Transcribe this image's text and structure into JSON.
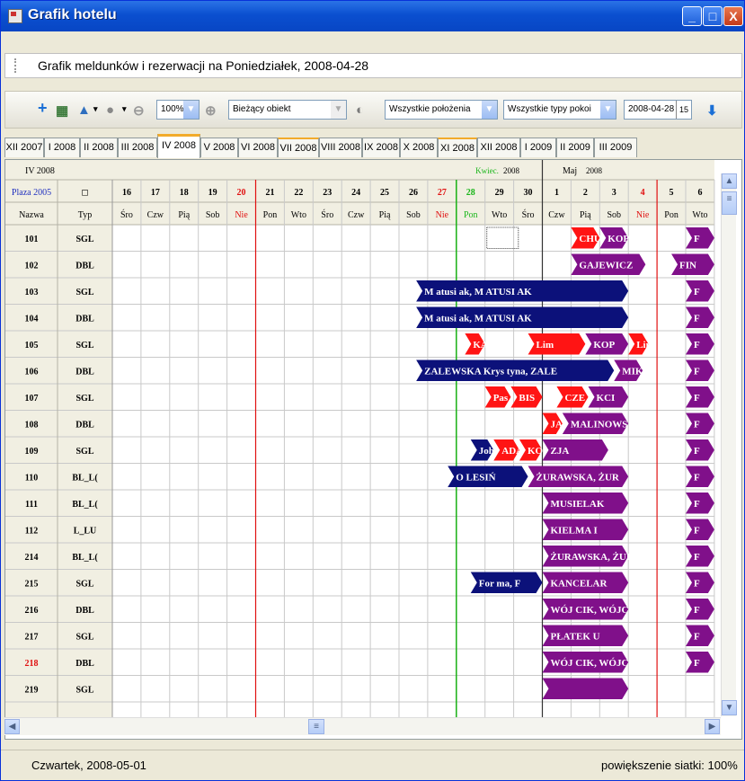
{
  "window": {
    "title": "Grafik hotelu"
  },
  "header": {
    "title": "Grafik meldunków i rezerwacji na Poniedziałek, 2008-04-28"
  },
  "toolbar": {
    "zoom": "100%",
    "object": "Bieżący obiekt",
    "location": "Wszystkie położenia",
    "room_type": "Wszystkie typy pokoi",
    "date": "2008-04-28",
    "calendar_icon": "15"
  },
  "tabs": [
    "XII 2007",
    "I 2008",
    "II 2008",
    "III 2008",
    "IV 2008",
    "V 2008",
    "VI 2008",
    "VII 2008",
    "VIII 2008",
    "IX 2008",
    "X 2008",
    "XI 2008",
    "XII 2008",
    "I 2009",
    "II 2009",
    "III 2009"
  ],
  "active_tab": "IV 2008",
  "grid": {
    "period_label": "IV 2008",
    "month_april": "Kwiec.",
    "month_april_year": "2008",
    "month_may": "Maj",
    "month_may_year": "2008",
    "object_label": "Plaza 2005",
    "col_name": "Nazwa",
    "col_type": "Typ",
    "days": [
      {
        "n": "16",
        "d": "Śro"
      },
      {
        "n": "17",
        "d": "Czw"
      },
      {
        "n": "18",
        "d": "Pią"
      },
      {
        "n": "19",
        "d": "Sob"
      },
      {
        "n": "20",
        "d": "Nie",
        "sun": true
      },
      {
        "n": "21",
        "d": "Pon"
      },
      {
        "n": "22",
        "d": "Wto"
      },
      {
        "n": "23",
        "d": "Śro"
      },
      {
        "n": "24",
        "d": "Czw"
      },
      {
        "n": "25",
        "d": "Pią"
      },
      {
        "n": "26",
        "d": "Sob"
      },
      {
        "n": "27",
        "d": "Nie",
        "sun": true
      },
      {
        "n": "28",
        "d": "Pon",
        "today": true
      },
      {
        "n": "29",
        "d": "Wto"
      },
      {
        "n": "30",
        "d": "Śro"
      },
      {
        "n": "1",
        "d": "Czw"
      },
      {
        "n": "2",
        "d": "Pią"
      },
      {
        "n": "3",
        "d": "Sob"
      },
      {
        "n": "4",
        "d": "Nie",
        "sun": true
      },
      {
        "n": "5",
        "d": "Pon"
      },
      {
        "n": "6",
        "d": "Wto"
      }
    ],
    "rooms": [
      {
        "room": "101",
        "type": "SGL"
      },
      {
        "room": "102",
        "type": "DBL"
      },
      {
        "room": "103",
        "type": "SGL"
      },
      {
        "room": "104",
        "type": "DBL"
      },
      {
        "room": "105",
        "type": "SGL"
      },
      {
        "room": "106",
        "type": "DBL"
      },
      {
        "room": "107",
        "type": "SGL"
      },
      {
        "room": "108",
        "type": "DBL"
      },
      {
        "room": "109",
        "type": "SGL"
      },
      {
        "room": "110",
        "type": "BL_L("
      },
      {
        "room": "111",
        "type": "BL_L("
      },
      {
        "room": "112",
        "type": "L_LU"
      },
      {
        "room": "214",
        "type": "BL_L("
      },
      {
        "room": "215",
        "type": "SGL"
      },
      {
        "room": "216",
        "type": "DBL"
      },
      {
        "room": "217",
        "type": "SGL"
      },
      {
        "room": "218",
        "type": "DBL",
        "red": true
      },
      {
        "room": "219",
        "type": "SGL"
      }
    ],
    "bookings": [
      {
        "row": 0,
        "start": 16,
        "end": 17,
        "color": "red",
        "label": "CHU"
      },
      {
        "row": 0,
        "start": 17,
        "end": 18,
        "color": "purple",
        "label": "KOP"
      },
      {
        "row": 0,
        "start": 20,
        "end": 21,
        "color": "purple",
        "label": "F"
      },
      {
        "row": 1,
        "start": 16,
        "end": 18.6,
        "color": "purple",
        "label": "GAJEWICZ"
      },
      {
        "row": 1,
        "start": 19.5,
        "end": 21,
        "color": "purple",
        "label": "FIN"
      },
      {
        "row": 2,
        "start": 10.6,
        "end": 18,
        "color": "navy",
        "label": "M atusi ak, M ATUSI AK"
      },
      {
        "row": 2,
        "start": 20,
        "end": 21,
        "color": "purple",
        "label": "F"
      },
      {
        "row": 3,
        "start": 10.6,
        "end": 18,
        "color": "navy",
        "label": "M atusi ak, M ATUSI AK"
      },
      {
        "row": 3,
        "start": 20,
        "end": 21,
        "color": "purple",
        "label": "F"
      },
      {
        "row": 4,
        "start": 12.3,
        "end": 13,
        "color": "red",
        "label": "KAC"
      },
      {
        "row": 4,
        "start": 14.5,
        "end": 16.5,
        "color": "red",
        "label": "Lim"
      },
      {
        "row": 4,
        "start": 16.5,
        "end": 18,
        "color": "purple",
        "label": "KOP"
      },
      {
        "row": 4,
        "start": 18,
        "end": 18.7,
        "color": "red",
        "label": "Lim"
      },
      {
        "row": 4,
        "start": 20,
        "end": 21,
        "color": "purple",
        "label": "F"
      },
      {
        "row": 5,
        "start": 10.6,
        "end": 17.5,
        "color": "navy",
        "label": "ZALEWSKA Krys tyna, ZALE"
      },
      {
        "row": 5,
        "start": 17.5,
        "end": 18.5,
        "color": "purple",
        "label": "MIK"
      },
      {
        "row": 5,
        "start": 20,
        "end": 21,
        "color": "purple",
        "label": "F"
      },
      {
        "row": 6,
        "start": 13,
        "end": 13.9,
        "color": "red",
        "label": "Pas"
      },
      {
        "row": 6,
        "start": 13.9,
        "end": 15,
        "color": "red",
        "label": "BIS"
      },
      {
        "row": 6,
        "start": 15.5,
        "end": 16.6,
        "color": "red",
        "label": "CZE"
      },
      {
        "row": 6,
        "start": 16.6,
        "end": 18,
        "color": "purple",
        "label": "KCI"
      },
      {
        "row": 6,
        "start": 20,
        "end": 21,
        "color": "purple",
        "label": "F"
      },
      {
        "row": 7,
        "start": 15,
        "end": 15.7,
        "color": "red",
        "label": "JAR"
      },
      {
        "row": 7,
        "start": 15.7,
        "end": 18,
        "color": "purple",
        "label": "MALINOWS"
      },
      {
        "row": 7,
        "start": 20,
        "end": 21,
        "color": "purple",
        "label": "F"
      },
      {
        "row": 8,
        "start": 12.5,
        "end": 13.3,
        "color": "navy",
        "label": "Joh"
      },
      {
        "row": 8,
        "start": 13.3,
        "end": 14.2,
        "color": "red",
        "label": "ADA"
      },
      {
        "row": 8,
        "start": 14.2,
        "end": 15,
        "color": "red",
        "label": "KOC"
      },
      {
        "row": 8,
        "start": 15,
        "end": 17.3,
        "color": "purple",
        "label": "ZJA"
      },
      {
        "row": 8,
        "start": 20,
        "end": 21,
        "color": "purple",
        "label": "F"
      },
      {
        "row": 9,
        "start": 11.7,
        "end": 14.5,
        "color": "navy",
        "label": "O LESIŃ"
      },
      {
        "row": 9,
        "start": 14.5,
        "end": 18,
        "color": "purple",
        "label": "ŻURAWSKA, ŻUR"
      },
      {
        "row": 9,
        "start": 20,
        "end": 21,
        "color": "purple",
        "label": "F"
      },
      {
        "row": 10,
        "start": 15,
        "end": 18,
        "color": "purple",
        "label": "MUSIELAK"
      },
      {
        "row": 10,
        "start": 20,
        "end": 21,
        "color": "purple",
        "label": "F"
      },
      {
        "row": 11,
        "start": 15,
        "end": 18,
        "color": "purple",
        "label": "KIELMA I"
      },
      {
        "row": 11,
        "start": 20,
        "end": 21,
        "color": "purple",
        "label": "F"
      },
      {
        "row": 12,
        "start": 15,
        "end": 18,
        "color": "purple",
        "label": "ŻURAWSKA, ŻUR"
      },
      {
        "row": 12,
        "start": 20,
        "end": 21,
        "color": "purple",
        "label": "F"
      },
      {
        "row": 13,
        "start": 12.5,
        "end": 15,
        "color": "navy",
        "label": "For ma, F"
      },
      {
        "row": 13,
        "start": 15,
        "end": 18,
        "color": "purple",
        "label": "KANCELAR"
      },
      {
        "row": 13,
        "start": 20,
        "end": 21,
        "color": "purple",
        "label": "F"
      },
      {
        "row": 14,
        "start": 15,
        "end": 18,
        "color": "purple",
        "label": "WÓJ CIK, WÓJCI"
      },
      {
        "row": 14,
        "start": 20,
        "end": 21,
        "color": "purple",
        "label": "F"
      },
      {
        "row": 15,
        "start": 15,
        "end": 18,
        "color": "purple",
        "label": "PŁATEK U"
      },
      {
        "row": 15,
        "start": 20,
        "end": 21,
        "color": "purple",
        "label": "F"
      },
      {
        "row": 16,
        "start": 15,
        "end": 18,
        "color": "purple",
        "label": "WÓJ CIK, WÓJCI"
      },
      {
        "row": 16,
        "start": 20,
        "end": 21,
        "color": "purple",
        "label": "F"
      },
      {
        "row": 17,
        "start": 15,
        "end": 18,
        "color": "purple",
        "label": ""
      }
    ]
  },
  "status": {
    "date": "Czwartek, 2008-05-01",
    "zoom": "powiększenie siatki: 100%"
  },
  "colors": {
    "navy": "#0c117a",
    "red": "#ff1414",
    "purple": "#80108a",
    "sunday": "#e01010",
    "today": "#19b519"
  }
}
